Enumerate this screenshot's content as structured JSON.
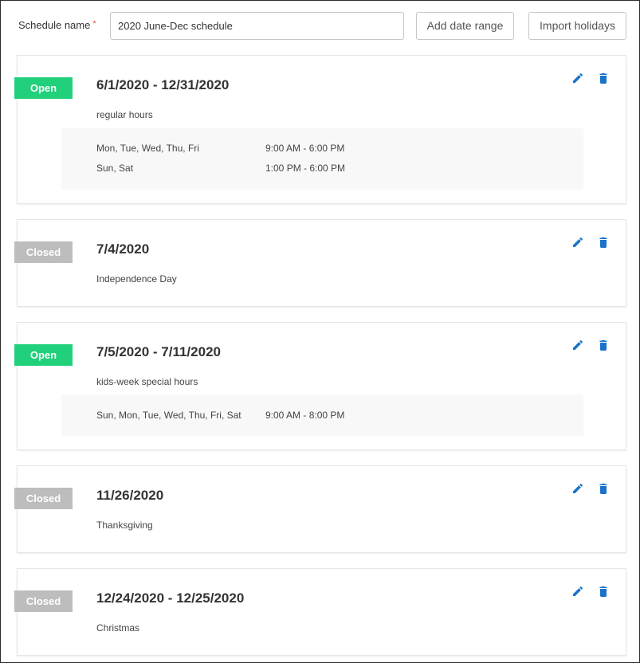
{
  "header": {
    "schedule_label": "Schedule name",
    "required_mark": "*",
    "schedule_value": "2020 June-Dec schedule",
    "add_date_range": "Add date range",
    "import_holidays": "Import holidays"
  },
  "colors": {
    "open": "#21d07a",
    "closed": "#bdbdbd",
    "icon_blue": "#1a73c8"
  },
  "icons": {
    "edit": "pencil-icon",
    "delete": "trash-icon"
  },
  "cards": [
    {
      "status": "Open",
      "title": "6/1/2020 - 12/31/2020",
      "description": "regular hours",
      "hours": [
        {
          "days": "Mon, Tue, Wed, Thu, Fri",
          "time": "9:00 AM - 6:00 PM"
        },
        {
          "days": "Sun, Sat",
          "time": "1:00 PM - 6:00 PM"
        }
      ]
    },
    {
      "status": "Closed",
      "title": "7/4/2020",
      "description": "Independence Day",
      "hours": []
    },
    {
      "status": "Open",
      "title": "7/5/2020 - 7/11/2020",
      "description": "kids-week special hours",
      "hours": [
        {
          "days": "Sun, Mon, Tue, Wed, Thu, Fri, Sat",
          "time": "9:00 AM - 8:00 PM"
        }
      ]
    },
    {
      "status": "Closed",
      "title": "11/26/2020",
      "description": "Thanksgiving",
      "hours": []
    },
    {
      "status": "Closed",
      "title": "12/24/2020 - 12/25/2020",
      "description": "Christmas",
      "hours": []
    }
  ]
}
